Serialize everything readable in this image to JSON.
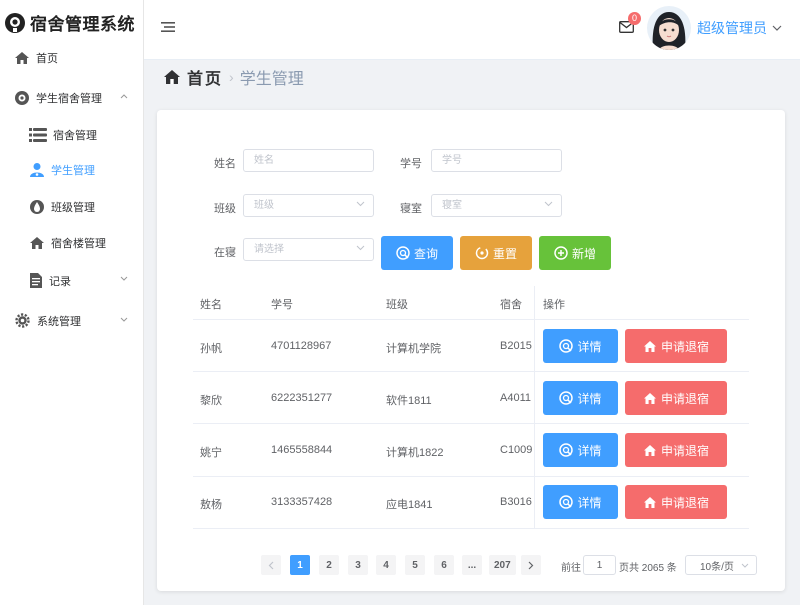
{
  "app": {
    "title": "宿舍管理系统"
  },
  "sidebar": {
    "items": [
      {
        "label": "首页",
        "icon": "home-icon"
      },
      {
        "label": "学生宿舍管理",
        "icon": "target-icon"
      },
      {
        "label": "宿舍管理",
        "icon": "list-icon"
      },
      {
        "label": "学生管理",
        "icon": "user-icon",
        "active": true
      },
      {
        "label": "班级管理",
        "icon": "droplet-icon"
      },
      {
        "label": "宿舍楼管理",
        "icon": "home-icon"
      },
      {
        "label": "记录",
        "icon": "document-icon"
      },
      {
        "label": "系统管理",
        "icon": "gear-icon"
      }
    ]
  },
  "header": {
    "badge_count": "0",
    "username": "超级管理员"
  },
  "breadcrumb": {
    "home": "首页",
    "current": "学生管理"
  },
  "form": {
    "name_label": "姓名",
    "name_placeholder": "姓名",
    "id_label": "学号",
    "id_placeholder": "学号",
    "class_label": "班级",
    "class_placeholder": "班级",
    "room_label": "寝室",
    "room_placeholder": "寝室",
    "status_label": "在寝",
    "status_placeholder": "请选择",
    "query_button": "查询",
    "reset_button": "重置",
    "add_button": "新增"
  },
  "table": {
    "headers": [
      "姓名",
      "学号",
      "班级",
      "宿舍",
      "操作"
    ],
    "rows": [
      {
        "name": "孙帆",
        "id": "4701128967",
        "class": "计算机学院",
        "room": "B2015"
      },
      {
        "name": "黎欣",
        "id": "6222351277",
        "class": "软件1811",
        "room": "A4011"
      },
      {
        "name": "姚宁",
        "id": "1465558844",
        "class": "计算机1822",
        "room": "C1009"
      },
      {
        "name": "敖杨",
        "id": "3133357428",
        "class": "应电1841",
        "room": "B3016"
      }
    ],
    "detail_button": "详情",
    "checkout_button": "申请退宿"
  },
  "pagination": {
    "pages": [
      "1",
      "2",
      "3",
      "4",
      "5",
      "6",
      "...",
      "207"
    ],
    "goto_label": "前往",
    "goto_value": "1",
    "total_text": "页共 2065 条",
    "page_size": "10条/页"
  },
  "colors": {
    "primary": "#409eff",
    "warning": "#e6a23c",
    "success": "#67c23a",
    "danger": "#f56c6c"
  }
}
